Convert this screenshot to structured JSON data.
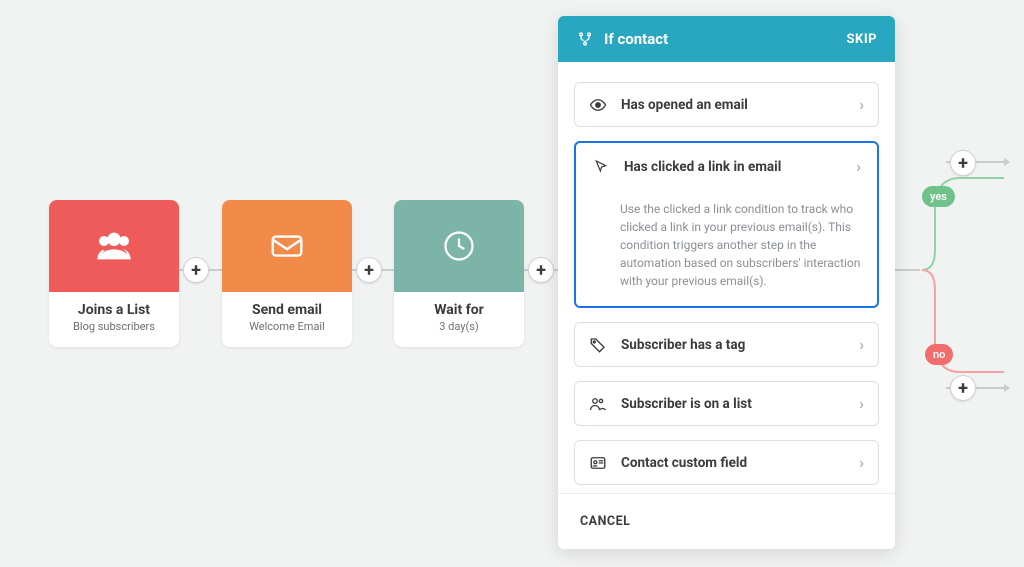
{
  "steps": [
    {
      "title": "Joins a List",
      "sub": "Blog subscribers"
    },
    {
      "title": "Send email",
      "sub": "Welcome Email"
    },
    {
      "title": "Wait for",
      "sub": "3 day(s)"
    }
  ],
  "panel": {
    "title": "If contact",
    "skip": "SKIP",
    "options": [
      {
        "title": "Has opened an email"
      },
      {
        "title": "Has clicked a link in email",
        "desc": "Use the clicked a link condition to track who clicked a link in your previous email(s). This condition triggers another step in the automation based on subscribers' interaction with your previous email(s)."
      },
      {
        "title": "Subscriber has a tag"
      },
      {
        "title": "Subscriber is on a list"
      },
      {
        "title": "Contact custom field"
      }
    ],
    "cancel": "CANCEL"
  },
  "branch": {
    "yes": "yes",
    "no": "no"
  }
}
